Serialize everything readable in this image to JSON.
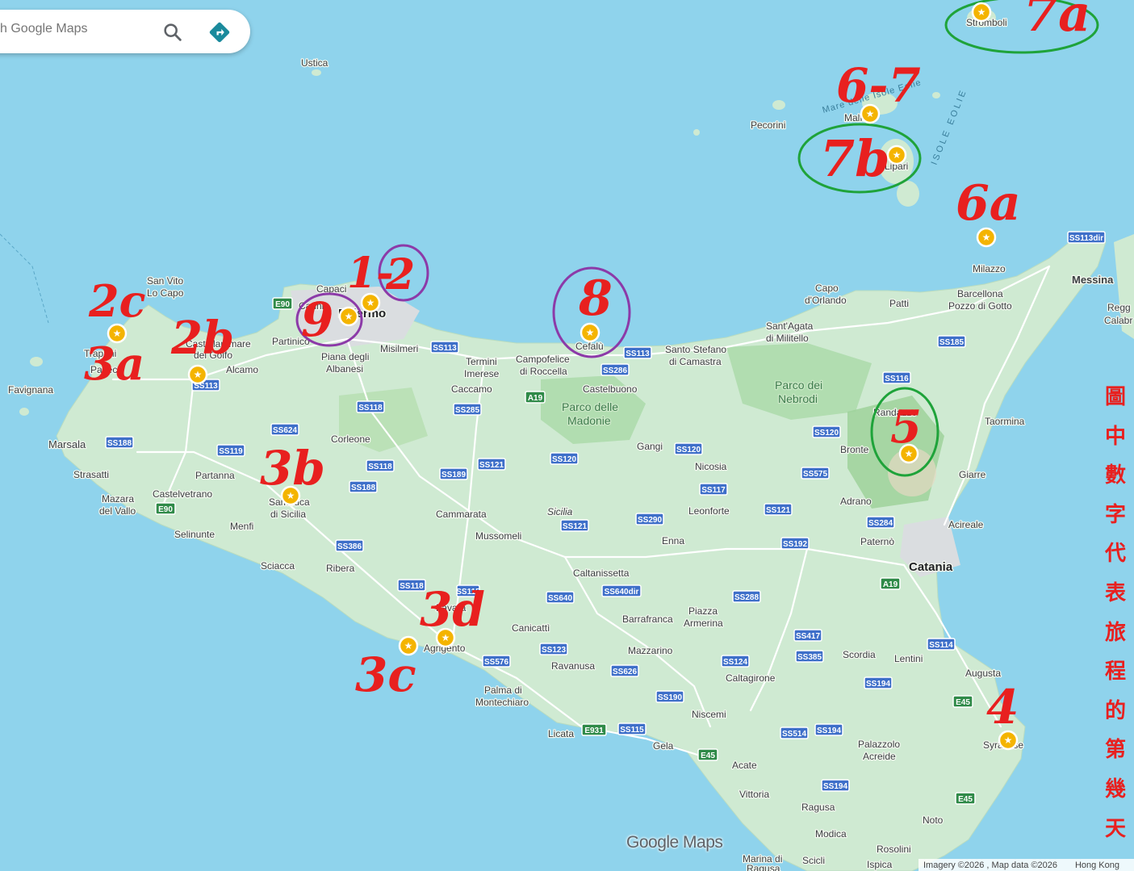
{
  "search": {
    "placeholder": "ch Google Maps"
  },
  "icons": {
    "search": "search-icon",
    "directions": "directions-icon",
    "marker": "star-marker-icon"
  },
  "colors": {
    "sea": "#8fd3ec",
    "land": "#cfead2",
    "annotation": "#e8201f",
    "ring_green": "#1fa33a",
    "ring_purple": "#8c3aa8",
    "marker": "#f4b400",
    "highway": "#3e6fc9"
  },
  "places": {
    "ustica": "Ustica",
    "stromboli": "Stromboli",
    "panarea_sea": "Mare delle Isole Eolie",
    "isole_eolie": "ISOLE EOLIE",
    "pecorini": "Pecorini",
    "malfa": "Malfa",
    "lipari": "Lipari",
    "milazzo": "Milazzo",
    "barcellona": "Barcellona",
    "pozzo": "Pozzo di Gotto",
    "messina": "Messina",
    "reggio": "Regg",
    "calabria": "Calabr",
    "capo_orlando_1": "Capo",
    "capo_orlando_2": "d'Orlando",
    "patti": "Patti",
    "santagata_1": "Sant'Agata",
    "santagata_2": "di Militello",
    "santo_stefano_1": "Santo Stefano",
    "santo_stefano_2": "di Camastra",
    "nebrodi_1": "Parco dei",
    "nebrodi_2": "Nebrodi",
    "randazzo": "Randazzo",
    "bronte": "Bronte",
    "taormina": "Taormina",
    "giarre": "Giarre",
    "adrano": "Adrano",
    "paterno": "Paternò",
    "acireale": "Acireale",
    "catania": "Catania",
    "augusta": "Augusta",
    "lentini": "Lentini",
    "scordia": "Scordia",
    "siracusa": "Syracuse",
    "palazzolo_1": "Palazzolo",
    "palazzolo_2": "Acreide",
    "noto": "Noto",
    "modica": "Modica",
    "rosolini": "Rosolini",
    "ispica": "Ispica",
    "scicli": "Scicli",
    "marina_1": "Marina di",
    "marina_2": "Ragusa",
    "ragusa": "Ragusa",
    "vittoria": "Vittoria",
    "acate": "Acate",
    "gela": "Gela",
    "niscemi": "Niscemi",
    "caltagirone": "Caltagirone",
    "mazzarino": "Mazzarino",
    "piazza_1": "Piazza",
    "piazza_2": "Armerina",
    "barrafranca": "Barrafranca",
    "enna": "Enna",
    "leonforte": "Leonforte",
    "nicosia": "Nicosia",
    "gangi": "Gangi",
    "caltanissetta": "Caltanissetta",
    "sicilia": "Sicilia",
    "castelbuono": "Castelbuono",
    "madonie_1": "Parco delle",
    "madonie_2": "Madonie",
    "cefalu": "Cefalù",
    "campofelice_1": "Campofelice",
    "campofelice_2": "di Roccella",
    "termini_1": "Termini",
    "termini_2": "Imerese",
    "caccamo": "Caccamo",
    "misilmeri": "Misilmeri",
    "palermo": "Palermo",
    "capaci": "Capaci",
    "carini": "Carini",
    "partinico": "Partinico",
    "piana_1": "Piana degli",
    "piana_2": "Albanesi",
    "corleone": "Corleone",
    "san_vito_1": "San Vito",
    "san_vito_2": "Lo Capo",
    "trapani": "Trapani",
    "paceco": "Paceco",
    "castellammare_1": "Castellammare",
    "castellammare_2": "del Golfo",
    "alcamo": "Alcamo",
    "favignana": "Favignana",
    "marsala": "Marsala",
    "strasatti": "Strasatti",
    "mazara_1": "Mazara",
    "mazara_2": "del Vallo",
    "castelvetrano": "Castelvetrano",
    "selinunte": "Selinunte",
    "menfi": "Menfi",
    "partanna": "Partanna",
    "sambuca_1": "Sambuca",
    "sambuca_2": "di Sicilia",
    "sciacca": "Sciacca",
    "ribera": "Ribera",
    "cammarata": "Cammarata",
    "mussomeli": "Mussomeli",
    "canicatti": "Canicattì",
    "agrigento": "Agrigento",
    "favara": "Favara",
    "ravanusa": "Ravanusa",
    "palma_1": "Palma di",
    "palma_2": "Montechiaro",
    "licata": "Licata"
  },
  "roads": {
    "ss113dir": "SS113dir",
    "ss185": "SS185",
    "ss116": "SS116",
    "ss120a": "SS120",
    "ss575": "SS575",
    "ss284": "SS284",
    "ss121a": "SS121",
    "ss192": "SS192",
    "a19a": "A19",
    "ss114": "SS114",
    "e45a": "E45",
    "ss194a": "SS194",
    "e45b": "E45",
    "ss194b": "SS194",
    "ss194c": "SS194",
    "ss514": "SS514",
    "e45c": "E45",
    "ss417": "SS417",
    "ss385": "SS385",
    "ss124": "SS124",
    "ss288": "SS288",
    "ss190": "SS190",
    "ss115": "SS115",
    "e931": "E931",
    "ss626": "SS626",
    "ss123": "SS123",
    "ss576": "SS576",
    "ss640": "SS640",
    "ss640dir": "SS640dir",
    "ss290": "SS290",
    "ss117": "SS117",
    "ss120b": "SS120",
    "ss120c": "SS120",
    "ss121b": "SS121",
    "ss113a": "SS113",
    "ss286": "SS286",
    "a19b": "A19",
    "ss285": "SS285",
    "ss189": "SS189",
    "ss121c": "SS121",
    "ss118a": "SS118",
    "ss118b": "SS118",
    "ss188a": "SS188",
    "ss386": "SS386",
    "ss118c": "SS118",
    "ss113b": "SS113",
    "e90a": "E90",
    "ss624": "SS624",
    "ss119": "SS119",
    "ss188b": "SS188",
    "e90b": "E90",
    "ss113c": "SS113",
    "ss115b": "SS115"
  },
  "annotations": {
    "d7a": "7a",
    "d67": "6-7",
    "d7b": "7b",
    "d6a": "6a",
    "d12a": "1-",
    "d12b": "2",
    "d8": "8",
    "d9": "9",
    "d2c": "2c",
    "d3a": "3a",
    "d2b": "2b",
    "d3b": "3b",
    "d5": "5",
    "d3d": "3d",
    "d3c": "3c",
    "d4": "4"
  },
  "legend": [
    "圖",
    "中",
    "數",
    "字",
    "代",
    "表",
    "旅",
    "程",
    "的",
    "第",
    "幾",
    "天"
  ],
  "logo": "Google Maps",
  "footer": {
    "attribution": "Imagery ©2026 , Map data ©2026",
    "region": "Hong Kong"
  }
}
